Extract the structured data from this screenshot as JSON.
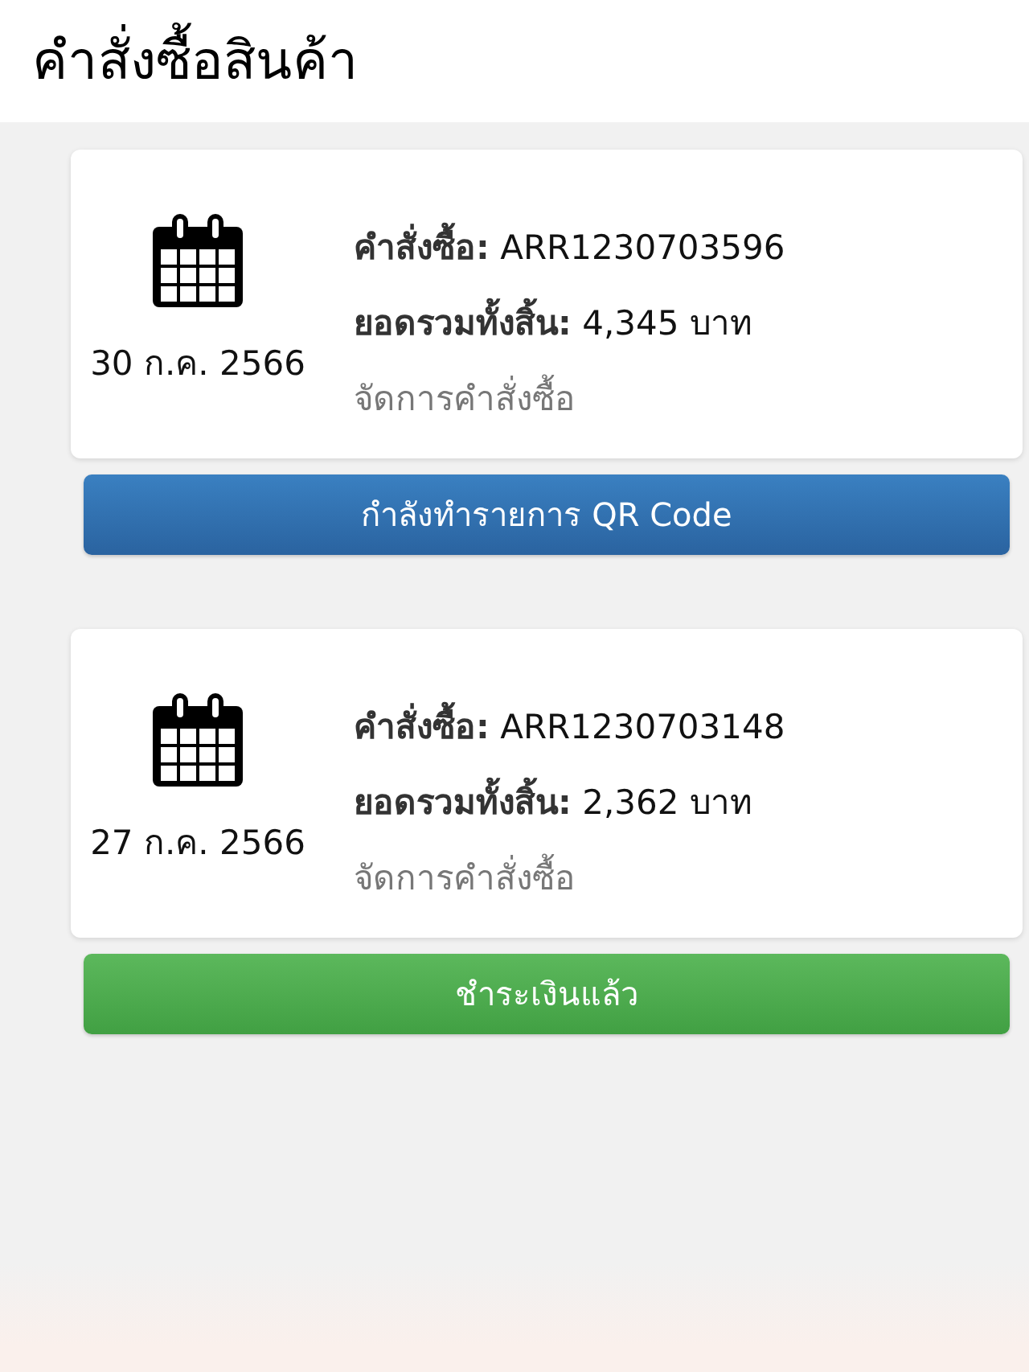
{
  "header": {
    "title": "คำสั่งซื้อสินค้า"
  },
  "orders": [
    {
      "date": "30 ก.ค. 2566",
      "order_line": "**คำสั่งซื้อ:** ARR1230703596",
      "total_line": "**ยอดรวมทั้งสิ้น:** 4,345 บาท",
      "manage_link": "จัดการคำสั่งซื้อ",
      "status": {
        "kind": "processing",
        "label": "กำลังทำรายการ QR Code"
      }
    },
    {
      "date": "27 ก.ค. 2566",
      "order_line": "**คำสั่งซื้อ:** ARR1230703148",
      "total_line": "**ยอดรวมทั้งสิ้น:** 2,362 บาท",
      "manage_link": "จัดการคำสั่งซื้อ",
      "status": {
        "kind": "paid",
        "label": "ชำระเงินแล้ว"
      }
    }
  ]
}
